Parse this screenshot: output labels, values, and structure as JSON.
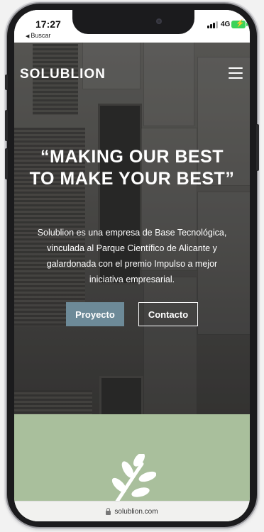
{
  "status_bar": {
    "time": "17:27",
    "back_label": "Buscar",
    "network": "4G"
  },
  "header": {
    "brand": "SOLUBLION",
    "menu_icon": "hamburger-menu-icon"
  },
  "hero": {
    "headline": "“MAKING OUR BEST TO MAKE YOUR BEST”",
    "description": "Solublion es una empresa de Base Tecnológica, vinculada al Parque Científico de Alicante y galardonada con el premio Impulso a mejor iniciativa empresarial.",
    "primary_button": "Proyecto",
    "secondary_button": "Contacto",
    "primary_color": "#6d8a98"
  },
  "section": {
    "background_color": "#a9bf9c",
    "icon": "leaf-icon"
  },
  "browser": {
    "url": "solublion.com"
  }
}
